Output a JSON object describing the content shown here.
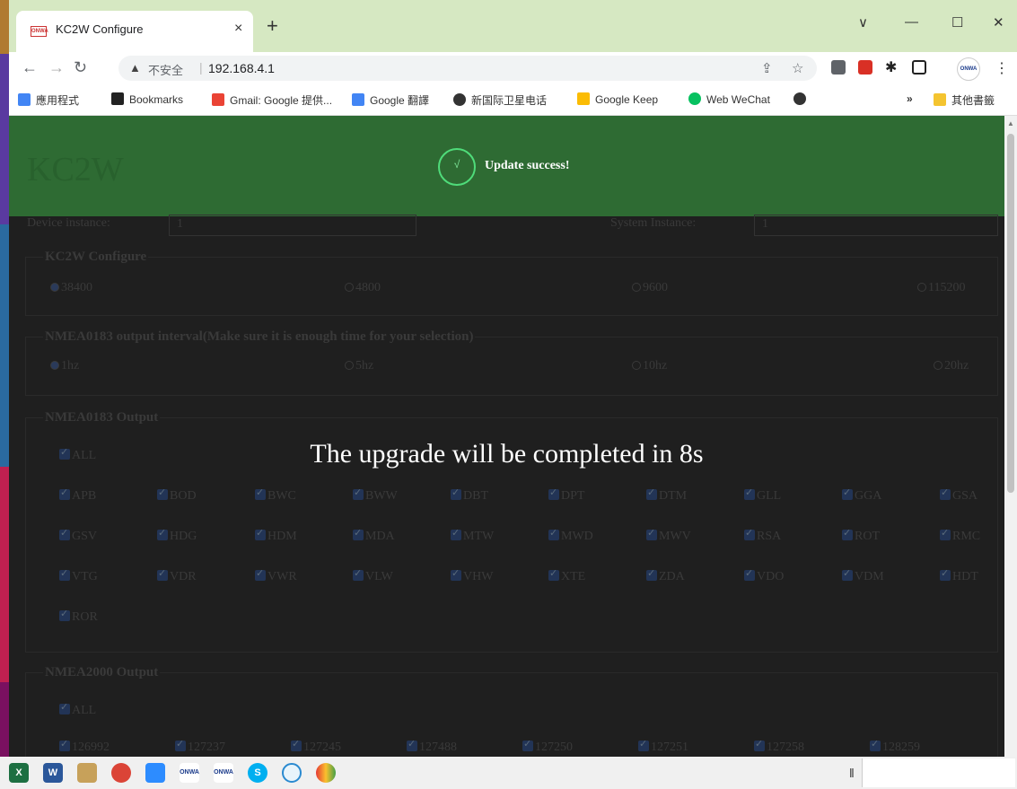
{
  "browser": {
    "tab_title": "KC2W Configure",
    "tab_favicon": "ONWA",
    "tab_close": "×",
    "new_tab": "+",
    "window_controls": {
      "chevron": "∨",
      "minimize": "—",
      "maximize": "☐",
      "close": "✕"
    },
    "insecure_label": "不安全",
    "url": "192.168.4.1",
    "profile_label": "ONWA",
    "bookmarks": [
      {
        "label": "應用程式",
        "color": "#4285f4"
      },
      {
        "label": "Bookmarks",
        "color": "#222222"
      },
      {
        "label": "Gmail: Google 提供...",
        "color": "#ea4335"
      },
      {
        "label": "Google 翻譯",
        "color": "#4285f4"
      },
      {
        "label": "新国际卫星电话",
        "color": "#333333"
      },
      {
        "label": "Google Keep",
        "color": "#fbbc04"
      },
      {
        "label": "Web WeChat",
        "color": "#07c160"
      },
      {
        "label": "",
        "color": "#333333"
      }
    ],
    "more_bookmarks": "»",
    "other_bookmarks": "其他書籤"
  },
  "page": {
    "toast": {
      "icon": "√",
      "message": "Update success!",
      "ghost_title": "KC2W"
    },
    "device_instance_label": "Device instance:",
    "device_instance_value": "1",
    "system_instance_label": "System Instance:",
    "system_instance_value": "1",
    "kc2w": {
      "legend": "KC2W Configure",
      "options": [
        "38400",
        "4800",
        "9600",
        "115200"
      ],
      "selected": 0
    },
    "interval": {
      "legend": "NMEA0183 output interval(Make sure it is enough time for your selection)",
      "options": [
        "1hz",
        "5hz",
        "10hz",
        "20hz"
      ],
      "selected": 0
    },
    "nmea0183": {
      "legend": "NMEA0183 Output",
      "all": "ALL",
      "rows": [
        [
          "APB",
          "BOD",
          "BWC",
          "BWW",
          "DBT",
          "DPT",
          "DTM",
          "GLL",
          "GGA",
          "GSA"
        ],
        [
          "GSV",
          "HDG",
          "HDM",
          "MDA",
          "MTW",
          "MWD",
          "MWV",
          "RSA",
          "ROT",
          "RMC"
        ],
        [
          "VTG",
          "VDR",
          "VWR",
          "VLW",
          "VHW",
          "XTE",
          "ZDA",
          "VDO",
          "VDM",
          "HDT"
        ],
        [
          "ROR"
        ]
      ]
    },
    "nmea2000": {
      "legend": "NMEA2000 Output",
      "all": "ALL",
      "rows": [
        [
          "126992",
          "127237",
          "127245",
          "127488",
          "127250",
          "127251",
          "127258",
          "128259"
        ]
      ]
    },
    "overlay_message": "The upgrade will be completed in 8s"
  },
  "taskbar": {
    "apps": [
      "excel-icon",
      "word-icon",
      "paint-icon",
      "chrome-icon",
      "zoom-icon",
      "onwa-nmea-icon",
      "onwa-tool-icon",
      "skype-icon",
      "cortana-icon",
      "photos-icon"
    ],
    "labels": [
      "X",
      "W",
      "",
      "",
      "",
      "ONWA",
      "ONWA",
      "S",
      "",
      ""
    ],
    "separator": "‖"
  }
}
